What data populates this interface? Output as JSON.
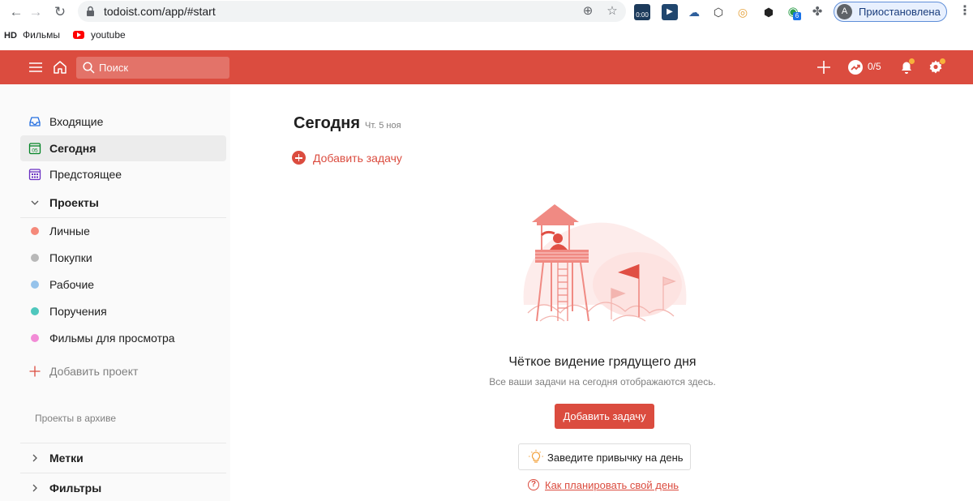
{
  "browser": {
    "url": "todoist.com/app/#start",
    "profile_initial": "A",
    "profile_label": "Приостановлена",
    "ext_badge_time": "0:00",
    "ext_badge_count": "6",
    "bookmarks": [
      {
        "label": "Фильмы",
        "prefix": "HD"
      },
      {
        "label": "youtube"
      }
    ]
  },
  "header": {
    "search_placeholder": "Поиск",
    "karma": "0/5",
    "accent_color": "#db4c3f"
  },
  "sidebar": {
    "nav": [
      {
        "label": "Входящие",
        "icon": "inbox-icon"
      },
      {
        "label": "Сегодня",
        "icon": "today-calendar-icon",
        "icon_text": "05",
        "active": true
      },
      {
        "label": "Предстоящее",
        "icon": "upcoming-calendar-icon"
      }
    ],
    "projects_header": "Проекты",
    "projects": [
      {
        "label": "Личные",
        "color": "#f5897a"
      },
      {
        "label": "Покупки",
        "color": "#b8b8b8"
      },
      {
        "label": "Рабочие",
        "color": "#96c3eb"
      },
      {
        "label": "Поручения",
        "color": "#4fc7bd"
      },
      {
        "label": "Фильмы для просмотра",
        "color": "#f28bd6"
      }
    ],
    "add_project": "Добавить проект",
    "archived": "Проекты в архиве",
    "labels_header": "Метки",
    "filters_header": "Фильтры"
  },
  "main": {
    "title": "Сегодня",
    "date": "Чт. 5 ноя",
    "add_task": "Добавить задачу",
    "empty_title": "Чёткое видение грядущего дня",
    "empty_subtitle": "Все ваши задачи на сегодня отображаются здесь.",
    "add_task_button": "Добавить задачу",
    "habit_button": "Заведите привычку на день",
    "help_link": "Как планировать свой день",
    "help_icon": "?"
  }
}
